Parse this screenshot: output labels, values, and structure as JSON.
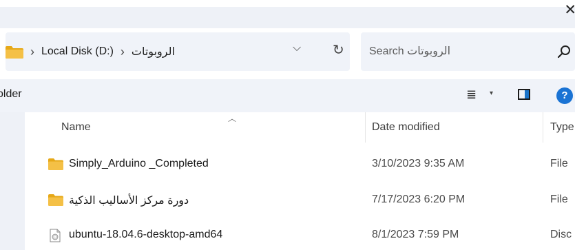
{
  "window": {
    "close_glyph": "✕"
  },
  "address": {
    "crumbs": [
      "Local Disk (D:)",
      "الروبوتات"
    ],
    "separator": "›",
    "dropdown_glyph": "⌵",
    "refresh_glyph": "↻"
  },
  "search": {
    "placeholder": "Search الروبوتات"
  },
  "toolbar": {
    "partial_label": "older",
    "view_glyph": "≣",
    "view_dropdown_glyph": "▾",
    "help_glyph": "?"
  },
  "columns": {
    "name": "Name",
    "date": "Date modified",
    "type": "Type",
    "sort_glyph": "︿"
  },
  "files": [
    {
      "name": "Simply_Arduino _Completed",
      "date": "3/10/2023 9:35 AM",
      "type": "File",
      "icon": "folder-icon",
      "rtl": false
    },
    {
      "name": "دورة مركز الأساليب الذكية",
      "date": "7/17/2023 6:20 PM",
      "type": "File",
      "icon": "folder-icon",
      "rtl": true
    },
    {
      "name": "ubuntu-18.04.6-desktop-amd64",
      "date": "8/1/2023 7:59 PM",
      "type": "Disc",
      "icon": "disc-image-icon",
      "rtl": false
    }
  ],
  "colors": {
    "folder": "#f4c046",
    "folder_dark": "#e6a817",
    "accent": "#1a73d4",
    "pane": "#f0f3f9"
  }
}
